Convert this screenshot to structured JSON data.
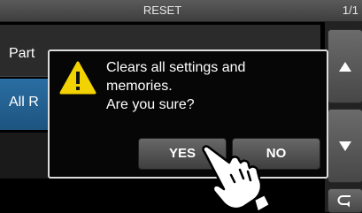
{
  "header": {
    "title": "RESET",
    "page_indicator": "1/1"
  },
  "menu": {
    "items": [
      {
        "label": "Part"
      },
      {
        "label": "All R"
      }
    ]
  },
  "dialog": {
    "message_lines": [
      "Clears all settings and",
      "memories.",
      "Are you sure?"
    ],
    "yes_label": "YES",
    "no_label": "NO",
    "icon": "warning-icon"
  },
  "sidebar": {
    "icons": [
      "arrow-up-icon",
      "arrow-down-icon",
      "back-icon"
    ]
  },
  "colors": {
    "selected_item": "#2a6ea3",
    "warning_yellow": "#f2d200",
    "dialog_border": "#dcdcdc"
  }
}
